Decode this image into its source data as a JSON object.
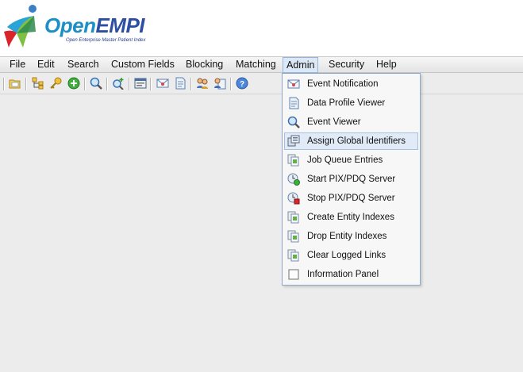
{
  "logo": {
    "title_open": "Open",
    "title_empi": "EMPI",
    "subtitle": "Open Enterprise Master Patient Index"
  },
  "menubar": {
    "items": [
      {
        "label": "File"
      },
      {
        "label": "Edit"
      },
      {
        "label": "Search"
      },
      {
        "label": "Custom Fields"
      },
      {
        "label": "Blocking"
      },
      {
        "label": "Matching"
      },
      {
        "label": "Admin",
        "active": true
      },
      {
        "label": "Security"
      },
      {
        "label": "Help"
      }
    ]
  },
  "toolbar": {
    "buttons": [
      {
        "icon": "open-folder-icon"
      },
      {
        "icon": "hierarchy-icon"
      },
      {
        "icon": "key-icon"
      },
      {
        "icon": "add-circle-icon"
      },
      {
        "icon": "search-icon"
      },
      {
        "icon": "search-add-icon"
      },
      {
        "icon": "window-icon"
      },
      {
        "icon": "mail-icon"
      },
      {
        "icon": "document-icon"
      },
      {
        "icon": "users-icon"
      },
      {
        "icon": "user-document-icon"
      },
      {
        "icon": "help-icon"
      }
    ]
  },
  "admin_menu": {
    "items": [
      {
        "label": "Event Notification",
        "icon": "mail-icon"
      },
      {
        "label": "Data Profile Viewer",
        "icon": "document-icon"
      },
      {
        "label": "Event Viewer",
        "icon": "magnifier-icon"
      },
      {
        "label": "Assign Global Identifiers",
        "icon": "global-id-icon",
        "highlighted": true
      },
      {
        "label": "Job Queue Entries",
        "icon": "pages-icon"
      },
      {
        "label": "Start PIX/PDQ Server",
        "icon": "server-start-icon"
      },
      {
        "label": "Stop PIX/PDQ Server",
        "icon": "server-stop-icon"
      },
      {
        "label": "Create Entity Indexes",
        "icon": "pages-icon"
      },
      {
        "label": "Drop Entity Indexes",
        "icon": "pages-icon"
      },
      {
        "label": "Clear Logged Links",
        "icon": "pages-icon"
      },
      {
        "label": "Information Panel",
        "icon": "checkbox-icon"
      }
    ]
  },
  "colors": {
    "open_text": "#1d8fc7",
    "empi_text": "#2c4fa3",
    "menu_highlight": "#e1ebf7",
    "menu_border": "#8fa8c9"
  }
}
